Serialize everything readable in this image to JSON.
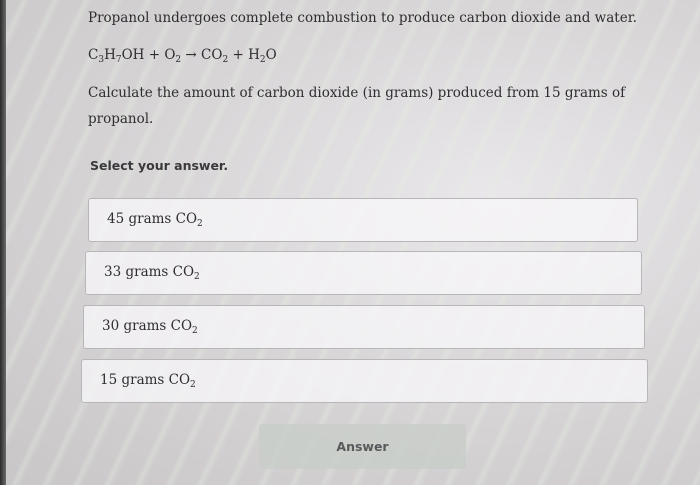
{
  "question": {
    "intro": "Propanol undergoes complete combustion to produce carbon dioxide and water.",
    "equation": {
      "c": "C",
      "c_sub": "3",
      "h": "H",
      "h_sub": "7",
      "oh_plus": "OH + O",
      "o2_sub": "2",
      "arrow": " → CO",
      "co2_sub": "2",
      "plus_h": " + H",
      "h2_sub": "2",
      "o_end": "O"
    },
    "calculate": "Calculate the amount of carbon dioxide (in grams) produced from 15 grams of propanol."
  },
  "select_prompt": "Select your answer.",
  "choices": [
    {
      "text": "45 grams CO",
      "sub": "2"
    },
    {
      "text": "33 grams CO",
      "sub": "2"
    },
    {
      "text": "30 grams CO",
      "sub": "2"
    },
    {
      "text": "15 grams CO",
      "sub": "2"
    }
  ],
  "answer_label": "Answer"
}
